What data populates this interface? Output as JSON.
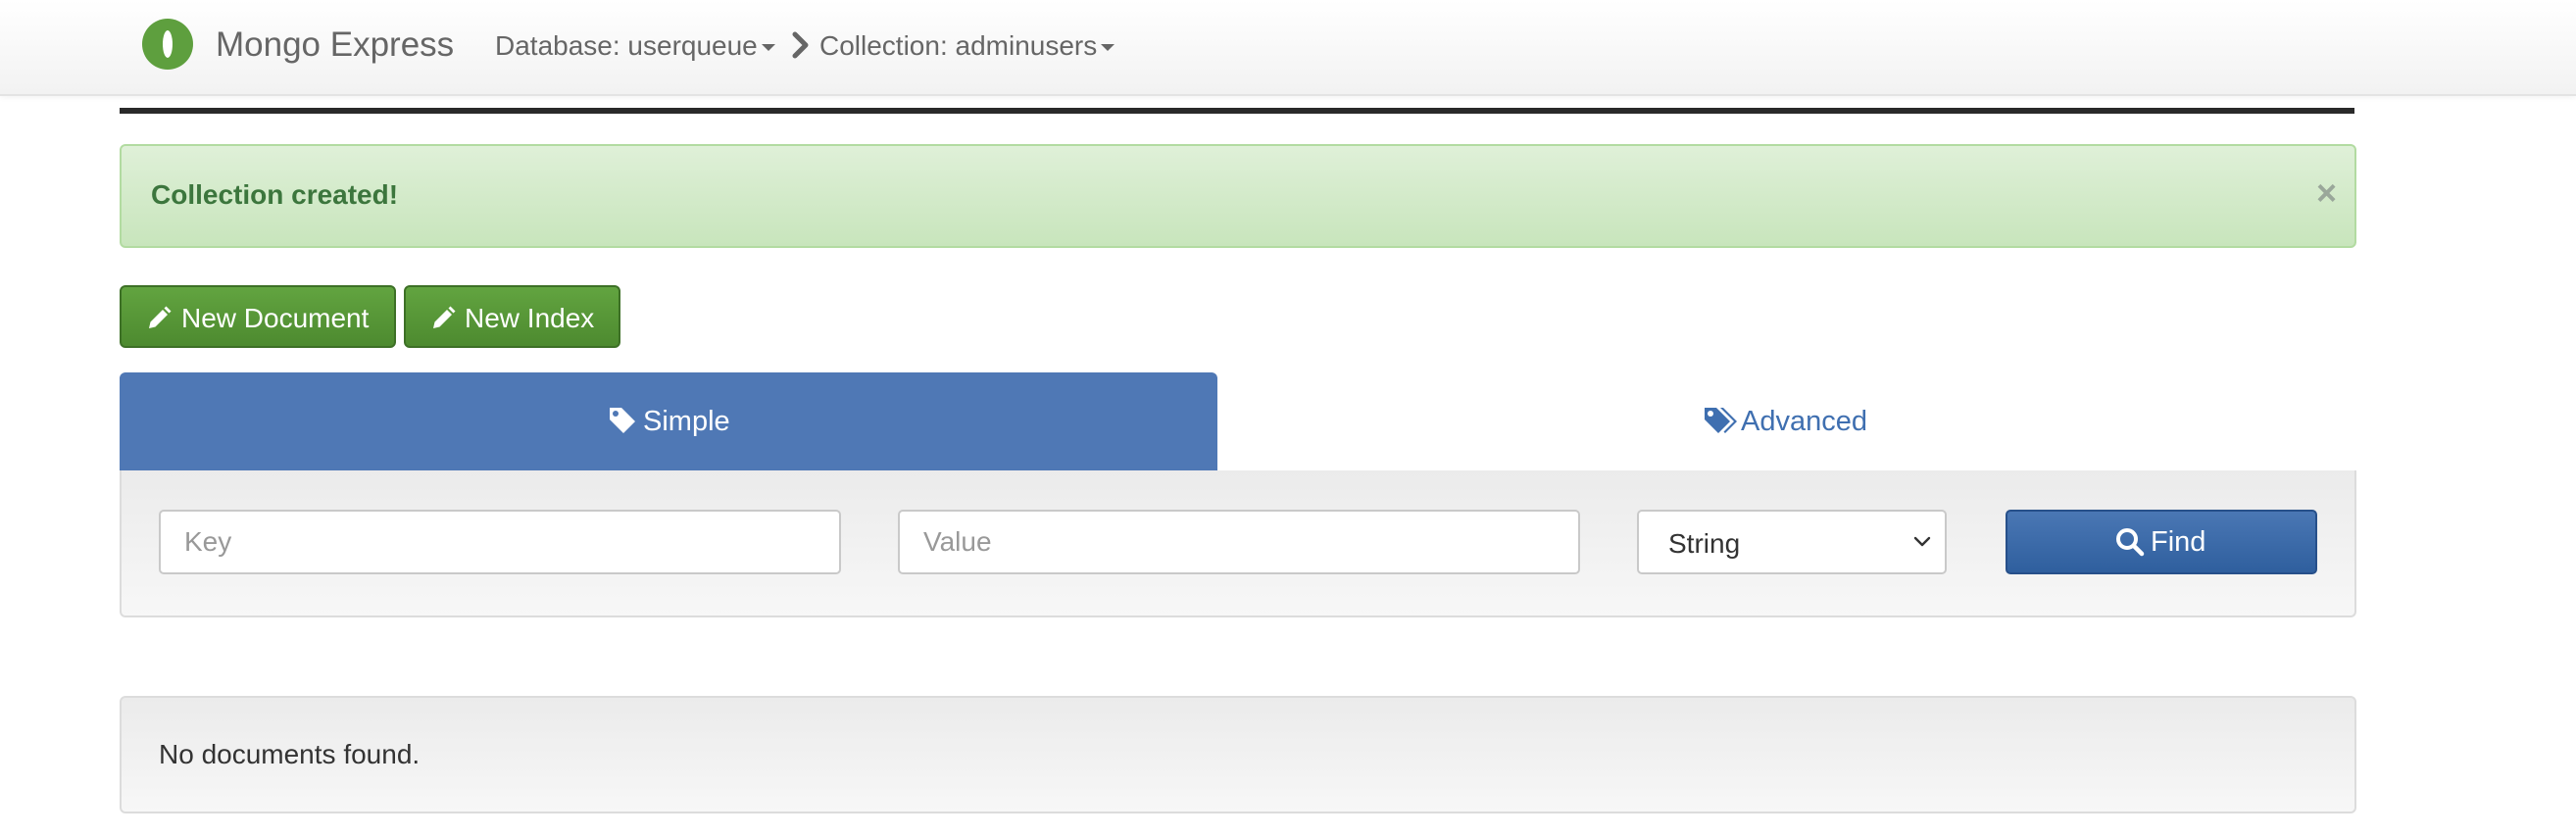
{
  "navbar": {
    "brand": "Mongo Express",
    "database_label": "Database: userqueue",
    "collection_label": "Collection: adminusers"
  },
  "alert": {
    "message": "Collection created!",
    "close_glyph": "×"
  },
  "actions": {
    "new_document_label": "New Document",
    "new_index_label": "New Index"
  },
  "tabs": {
    "simple_label": "Simple",
    "advanced_label": "Advanced",
    "active": "Simple"
  },
  "search": {
    "key_placeholder": "Key",
    "value_placeholder": "Value",
    "type_selected": "String",
    "find_label": "Find"
  },
  "results": {
    "empty_message": "No documents found."
  },
  "icons": {
    "logo": "mongodb-leaf-icon",
    "breadcrumb": "chevron-right-icon",
    "new_document": "pencil-icon",
    "new_index": "pencil-icon",
    "simple_tab": "tag-icon",
    "advanced_tab": "tags-icon",
    "find": "search-icon",
    "select": "chevron-down-icon"
  },
  "colors": {
    "brand_green": "#5e9f3e",
    "button_green": "#5a9a3a",
    "tab_blue": "#4f78b5",
    "find_blue": "#3a68a8",
    "alert_bg": "#dff0d8",
    "alert_text": "#3c763d",
    "link_blue": "#3f6fb0"
  }
}
